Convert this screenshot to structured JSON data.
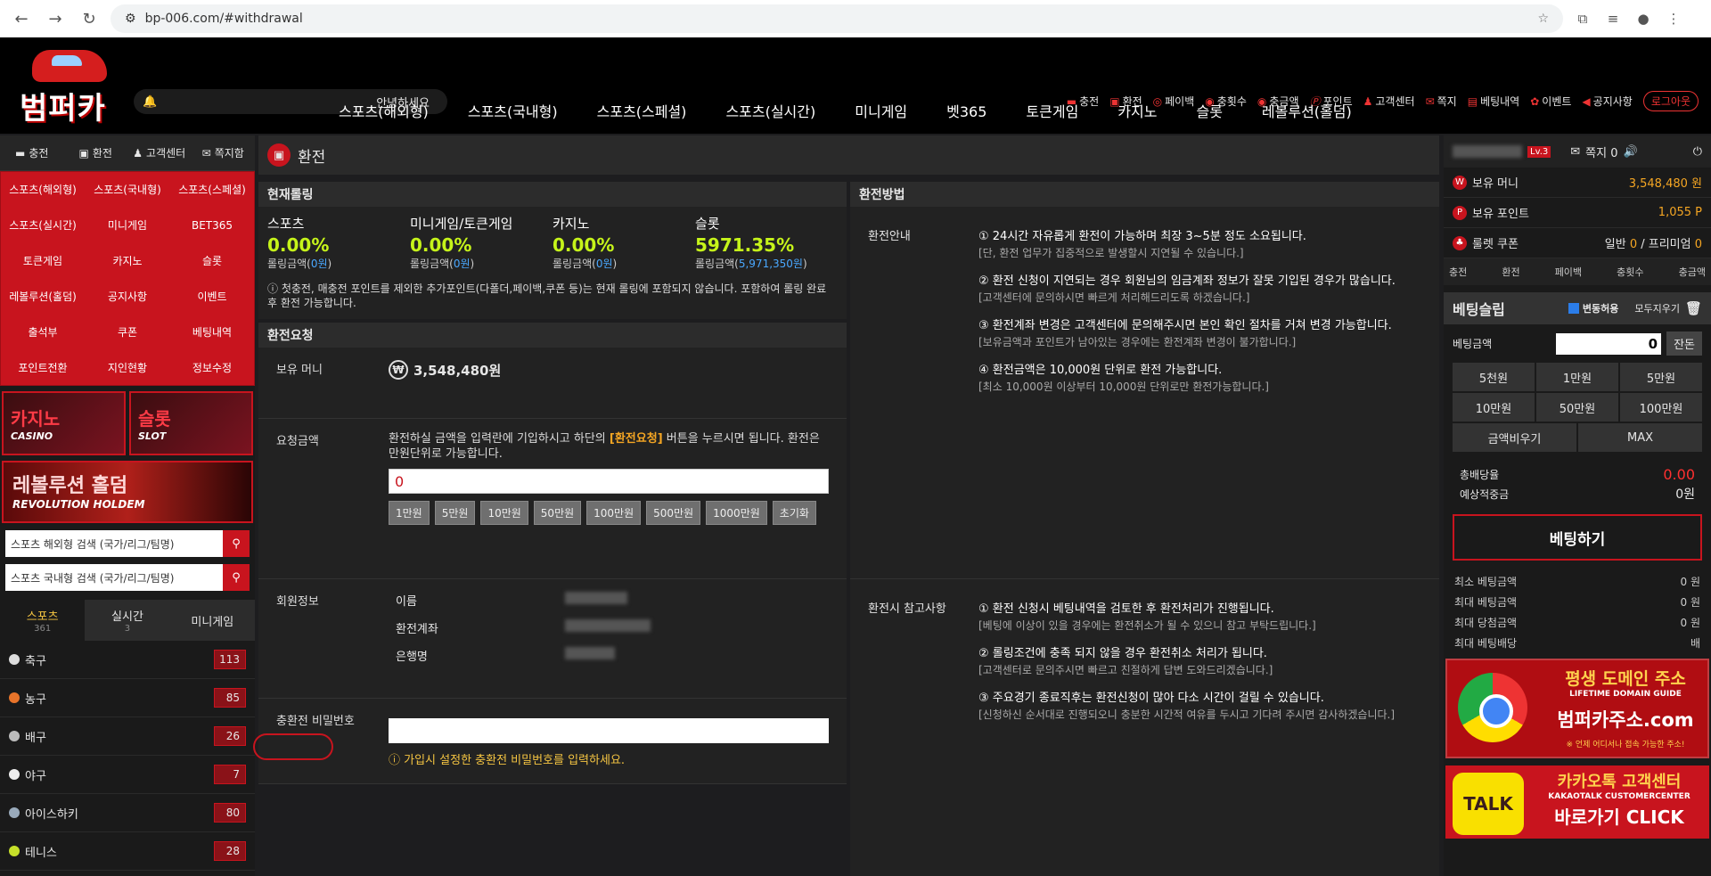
{
  "browser": {
    "url": "bp-006.com/#withdrawal"
  },
  "header": {
    "logo": "범퍼카",
    "notice": "안녕하세요",
    "links": [
      "충전",
      "환전",
      "페이백",
      "충횟수",
      "충금액",
      "포인트",
      "고객센터",
      "쪽지",
      "베팅내역",
      "이벤트",
      "공지사항"
    ],
    "logout": "로그아웃"
  },
  "nav": [
    "스포츠(해외형)",
    "스포츠(국내형)",
    "스포츠(스페셜)",
    "스포츠(실시간)",
    "미니게임",
    "벳365",
    "토큰게임",
    "카지노",
    "슬롯",
    "레볼루션(홀덤)"
  ],
  "left": {
    "quick": [
      "충전",
      "환전",
      "고객센터",
      "쪽지함"
    ],
    "grid": [
      "스포츠(해외형)",
      "스포츠(국내형)",
      "스포츠(스페셜)",
      "스포츠(실시간)",
      "미니게임",
      "BET365",
      "토큰게임",
      "카지노",
      "슬롯",
      "레볼루션(홀덤)",
      "공지사항",
      "이벤트",
      "출석부",
      "쿠폰",
      "베팅내역",
      "포인트전환",
      "지인현황",
      "정보수정"
    ],
    "banner_casino": {
      "t1": "카지노",
      "t2": "CASINO"
    },
    "banner_slot": {
      "t1": "슬롯",
      "t2": "SLOT"
    },
    "banner_holdem": {
      "t1": "레볼루션 홀덤",
      "t2": "REVOLUTION HOLDEM"
    },
    "search1": "스포츠 해외형 검색 (국가/리그/팀명)",
    "search2": "스포츠 국내형 검색 (국가/리그/팀명)",
    "tabs": [
      {
        "label": "스포츠",
        "count": "361"
      },
      {
        "label": "실시간",
        "count": "3"
      },
      {
        "label": "미니게임",
        "count": ""
      }
    ],
    "sports": [
      {
        "name": "축구",
        "count": "113",
        "color": "#ddd"
      },
      {
        "name": "농구",
        "count": "85",
        "color": "#e8742a"
      },
      {
        "name": "배구",
        "count": "26",
        "color": "#bbb"
      },
      {
        "name": "야구",
        "count": "7",
        "color": "#eee"
      },
      {
        "name": "아이스하키",
        "count": "80",
        "color": "#9ab"
      },
      {
        "name": "테니스",
        "count": "28",
        "color": "#c6e02a"
      }
    ]
  },
  "page": {
    "title": "환전"
  },
  "rolling": {
    "title": "현재롤링",
    "items": [
      {
        "label": "스포츠",
        "pct": "0.00%",
        "sub": "롤링금액(",
        "amt": "0원",
        "end": ")"
      },
      {
        "label": "미니게임/토큰게임",
        "pct": "0.00%",
        "sub": "롤링금액(",
        "amt": "0원",
        "end": ")"
      },
      {
        "label": "카지노",
        "pct": "0.00%",
        "sub": "롤링금액(",
        "amt": "0원",
        "end": ")"
      },
      {
        "label": "슬롯",
        "pct": "5971.35%",
        "sub": "롤링금액(",
        "amt": "5,971,350원",
        "end": ")"
      }
    ],
    "note": "ⓘ 첫충전, 매충전 포인트를 제외한 추가포인트(다폴더,페이백,쿠폰 등)는 현재 롤링에 포함되지 않습니다. 포함하여 롤링 완료 후 환전 가능합니다."
  },
  "request": {
    "title": "환전요청",
    "money_label": "보유 머니",
    "money": "3,548,480원",
    "amount_label": "요청금액",
    "desc1": "환전하실 금액을 입력란에 기입하시고 하단의 ",
    "desc_hl": "[환전요청]",
    "desc2": " 버튼을 누르시면 됩니다. 환전은 만원단위로 가능합니다.",
    "amount": "0",
    "chips": [
      "1만원",
      "5만원",
      "10만원",
      "50만원",
      "100만원",
      "500만원",
      "1000만원",
      "초기화"
    ],
    "member_label": "회원정보",
    "name_label": "이름",
    "account_label": "환전계좌",
    "bank_label": "은행명",
    "pw_label": "충환전 비밀번호",
    "pw_warn": "ⓘ 가입시 설정한 충환전 비밀번호를 입력하세요."
  },
  "method": {
    "title": "환전방법",
    "guide_label": "환전안내",
    "guide": [
      {
        "t": "① 24시간 자유롭게 환전이 가능하며 최장 3~5분 정도 소요됩니다.",
        "g": "[단, 환전 업무가 집중적으로 발생할시 지연될 수 있습니다.]"
      },
      {
        "t": "② 환전 신청이 지연되는 경우 회원님의 임금계좌 정보가 잘못 기입된 경우가 많습니다.",
        "g": "[고객센터에 문의하시면 빠르게 처리해드리도록 하겠습니다.]"
      },
      {
        "t": "③ 환전계좌 변경은 고객센터에 문의해주시면 본인 확인 절차를 거쳐 변경 가능합니다.",
        "g": "[보유금액과 포인트가 남아있는 경우에는 환전계좌 변경이 불가합니다.]"
      },
      {
        "t": "④ 환전금액은 10,000원 단위로 환전 가능합니다.",
        "g": "[최소 10,000원 이상부터 10,000원 단위로만 환전가능합니다.]"
      }
    ],
    "ref_label": "환전시 참고사항",
    "ref": [
      {
        "t": "① 환전 신청시 베팅내역을 검토한 후 환전처리가 진행됩니다.",
        "g": "[베팅에 이상이 있을 경우에는 환전취소가 될 수 있으니 참고 부탁드립니다.]"
      },
      {
        "t": "② 롤링조건에 충족 되지 않을 경우 환전취소 처리가 됩니다.",
        "g": "[고객센터로 문의주시면 빠르고 친절하게 답변 도와드리겠습니다.]"
      },
      {
        "t": "③ 주요경기 종료직후는 환전신청이 많아 다소 시간이 걸릴 수 있습니다.",
        "g": "[신청하신 순서대로 진행되오니 충분한 시간적 여유를 두시고 기다려 주시면 감사하겠습니다.]"
      }
    ]
  },
  "user": {
    "level": "Lv.3",
    "msg": "쪽지 0",
    "money_label": "보유 머니",
    "money": "3,548,480 원",
    "point_label": "보유 포인트",
    "point": "1,055 P",
    "coupon_label": "룰렛 쿠폰",
    "coupon1": "일반 ",
    "coupon1v": "0",
    "coupon2": " / 프리미엄 ",
    "coupon2v": "0",
    "links": [
      "충전",
      "환전",
      "페이백",
      "충횟수",
      "충금액"
    ]
  },
  "slip": {
    "title": "베팅슬립",
    "toggle": "변동허용",
    "clear": "모두지우기",
    "bet_label": "베팅금액",
    "bet": "0",
    "rest": "잔돈",
    "amounts": [
      "5천원",
      "1만원",
      "5만원",
      "10만원",
      "50만원",
      "100만원"
    ],
    "reset": "금액비우기",
    "max": "MAX",
    "odds_label": "총배당율",
    "odds": "0.00",
    "win_label": "예상적중금",
    "win": "0원",
    "bet_button": "베팅하기",
    "limits": [
      {
        "k": "최소 베팅금액",
        "v": "0 원"
      },
      {
        "k": "최대 베팅금액",
        "v": "0 원"
      },
      {
        "k": "최대 당첨금액",
        "v": "0 원"
      },
      {
        "k": "최대 베팅배당",
        "v": "배"
      }
    ]
  },
  "ads": {
    "domain": {
      "t1": "평생 도메인 주소",
      "t2": "LIFETIME DOMAIN GUIDE",
      "t3": "범퍼카주소.com",
      "t4": "※ 언제 어디서나 접속 가능한 주소!"
    },
    "kakao": {
      "talk": "TALK",
      "t1": "카카오톡 고객센터",
      "t2": "KAKAOTALK CUSTOMERCENTER",
      "t3": "바로가기 CLICK"
    }
  }
}
